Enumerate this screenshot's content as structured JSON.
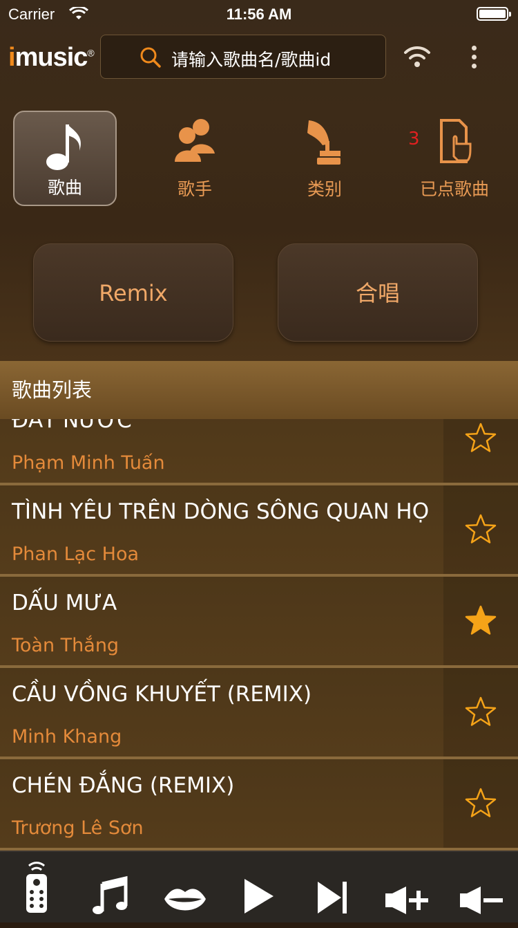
{
  "status": {
    "carrier": "Carrier",
    "time": "11:56 AM"
  },
  "header": {
    "logo_i": "i",
    "logo_rest": "music",
    "logo_reg": "®",
    "search_placeholder": "请输入歌曲名/歌曲id"
  },
  "tabs": [
    {
      "label": "歌曲",
      "icon": "music-note-icon",
      "active": true
    },
    {
      "label": "歌手",
      "icon": "singers-icon",
      "active": false
    },
    {
      "label": "类别",
      "icon": "gramophone-icon",
      "active": false
    },
    {
      "label": "已点歌曲",
      "icon": "selected-songs-icon",
      "active": false,
      "badge": "3"
    }
  ],
  "categories": [
    "Remix",
    "合唱"
  ],
  "list_header": "歌曲列表",
  "songs": [
    {
      "title": "ĐẤT NƯỚC",
      "artist": "Phạm Minh Tuấn",
      "favorite": false
    },
    {
      "title": "TÌNH YÊU TRÊN DÒNG SÔNG QUAN HỌ",
      "artist": "Phan Lạc Hoa",
      "favorite": false
    },
    {
      "title": "DẤU MƯA",
      "artist": "Toàn Thắng",
      "favorite": true
    },
    {
      "title": "CẦU VỒNG KHUYẾT (REMIX)",
      "artist": "Minh Khang",
      "favorite": false
    },
    {
      "title": "CHÉN ĐẮNG (REMIX)",
      "artist": "Trương Lê Sơn",
      "favorite": false
    }
  ],
  "toolbar": [
    "remote-icon",
    "music-icon",
    "lips-icon",
    "play-icon",
    "next-icon",
    "volume-up-icon",
    "volume-down-icon"
  ],
  "colors": {
    "accent": "#e48a3a",
    "star": "#f5a318"
  }
}
